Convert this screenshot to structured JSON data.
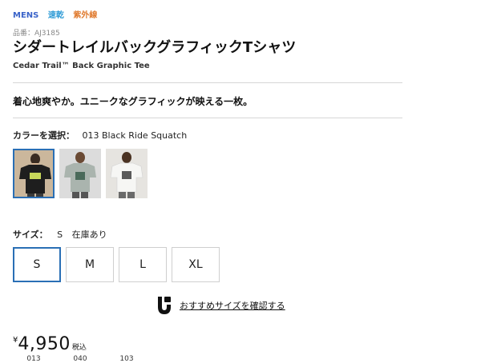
{
  "tags": [
    "MENS",
    "速乾",
    "紫外線"
  ],
  "sku": "品番：AJ3185",
  "title": "シダートレイルバックグラフィックTシャツ",
  "subtitle": "Cedar Trail™ Back Graphic Tee",
  "catchcopy": "着心地爽やか。ユニークなグラフィックが映える一枚。",
  "color": {
    "label": "カラーを選択：",
    "selected": "013 Black Ride Squatch",
    "swatches": [
      {
        "code": "013",
        "shirt_color": "#1e1e1e",
        "bg_color": "#cbb79c",
        "selected": true
      },
      {
        "code": "040",
        "shirt_color": "#aab4ae",
        "bg_color": "#dcdcdc",
        "selected": false
      },
      {
        "code": "103",
        "shirt_color": "#f6f6f4",
        "bg_color": "#e6e4e0",
        "selected": false
      }
    ]
  },
  "size": {
    "label": "サイズ：",
    "selected": "S",
    "stock": "在庫あり",
    "options": [
      {
        "label": "S",
        "selected": true
      },
      {
        "label": "M",
        "selected": false
      },
      {
        "label": "L",
        "selected": false
      },
      {
        "label": "XL",
        "selected": false
      }
    ]
  },
  "recommend": {
    "icon": "size-recommend-icon",
    "text": "おすすめサイズを確認する"
  },
  "price": {
    "currency": "¥",
    "amount": "4,950",
    "tax": "税込"
  },
  "colors": {
    "accent": "#2a6fb5",
    "mens": "#3a63c9",
    "quick_dry": "#2e9bd6",
    "uv": "#e07a2e"
  }
}
